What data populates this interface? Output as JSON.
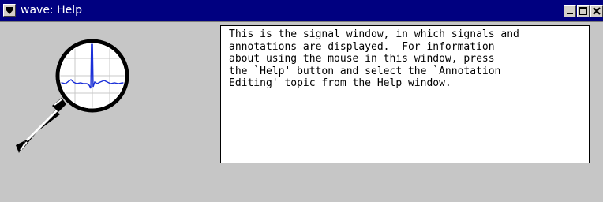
{
  "window": {
    "title": "wave: Help"
  },
  "icons": {
    "window_menu": "window-menu-icon",
    "minimize": "minimize-icon",
    "maximize": "maximize-icon",
    "close": "close-icon",
    "logo": "magnifier-ecg-logo"
  },
  "colors": {
    "titlebar": "#000080",
    "window_bg": "#c6c6c6",
    "signal": "#1a2fd8"
  },
  "help": {
    "text": "This is the signal window, in which signals and\nannotations are displayed.  For information\nabout using the mouse in this window, press\nthe `Help' button and select the `Annotation\nEditing' topic from the Help window."
  }
}
